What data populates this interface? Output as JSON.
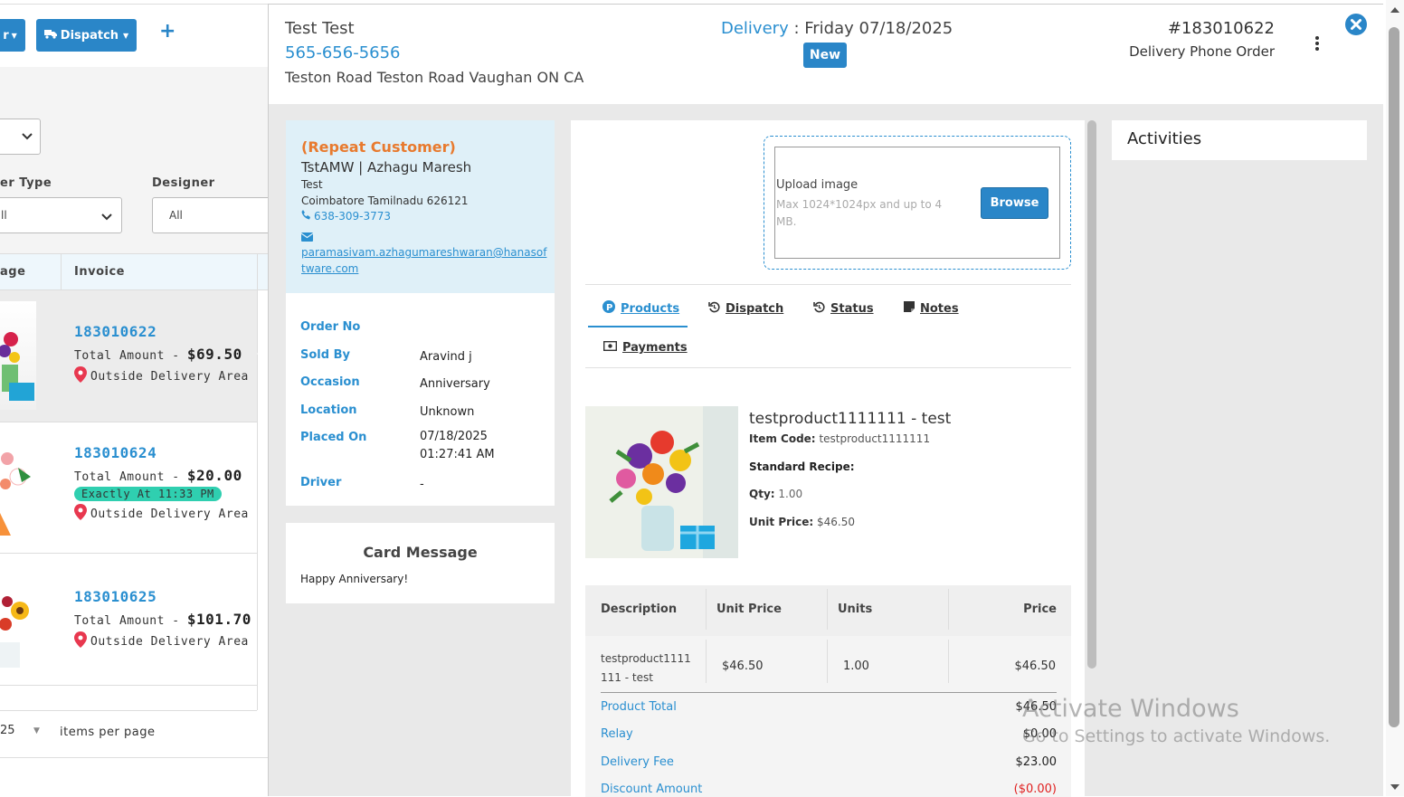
{
  "toolbar": {
    "partial_button_label": "r",
    "dispatch_label": "Dispatch",
    "add_label": "+"
  },
  "filters": {
    "order_type_label": "er Type",
    "order_type_value": "ll",
    "designer_label": "Designer",
    "designer_value": "All"
  },
  "list": {
    "col_stage": "age",
    "col_invoice": "Invoice",
    "rows": [
      {
        "invoice": "183010622",
        "amount_label": "Total Amount -",
        "amount": "$69.50",
        "badge": "",
        "location": "Outside Delivery Area"
      },
      {
        "invoice": "183010624",
        "amount_label": "Total Amount -",
        "amount": "$20.00",
        "badge": "Exactly At 11:33 PM",
        "location": "Outside Delivery Area"
      },
      {
        "invoice": "183010625",
        "amount_label": "Total Amount -",
        "amount": "$101.70",
        "badge": "",
        "location": "Outside Delivery Area"
      }
    ],
    "page_size": "25",
    "per_page_label": "items per page"
  },
  "header": {
    "customer_name": "Test Test",
    "phone": "565-656-5656",
    "address": "Teston Road Teston Road Vaughan ON CA",
    "delivery_label": "Delivery",
    "delivery_date": ": Friday 07/18/2025",
    "status_badge": "New",
    "order_number": "#183010622",
    "order_type": "Delivery Phone Order"
  },
  "customer_card": {
    "repeat_label": "(Repeat Customer)",
    "name": "TstAMW | Azhagu Maresh",
    "line1": "Test",
    "line2": "Coimbatore Tamilnadu 626121",
    "phone": "638-309-3773",
    "email_line1": "paramasivam.azhagumareshwaran@hanasof",
    "email_line2": "tware.com"
  },
  "order_details": [
    {
      "key": "Order No",
      "value": ""
    },
    {
      "key": "Sold By",
      "value": "Aravind j"
    },
    {
      "key": "Occasion",
      "value": "Anniversary"
    },
    {
      "key": "Location",
      "value": "Unknown"
    },
    {
      "key": "Placed On",
      "value": "07/18/2025 01:27:41 AM"
    },
    {
      "key": "Driver",
      "value": "-"
    }
  ],
  "card_message": {
    "title": "Card Message",
    "text": "Happy Anniversary!"
  },
  "upload": {
    "title": "Upload image",
    "hint": "Max 1024*1024px and up to 4 MB.",
    "browse_label": "Browse"
  },
  "tabs": {
    "products": "Products",
    "dispatch": "Dispatch",
    "status": "Status",
    "notes": "Notes",
    "payments": "Payments"
  },
  "product": {
    "name": "testproduct1111111 - test",
    "item_code_label": "Item Code:",
    "item_code": "testproduct1111111",
    "recipe_label": "Standard Recipe:",
    "qty_label": "Qty:",
    "qty": "1.00",
    "unit_price_label": "Unit Price:",
    "unit_price": "$46.50"
  },
  "line_table": {
    "headers": [
      "Description",
      "Unit Price",
      "Units",
      "Price"
    ],
    "row": {
      "description": "testproduct1111111 - test",
      "unit_price": "$46.50",
      "units": "1.00",
      "price": "$46.50"
    }
  },
  "totals": [
    {
      "label": "Product Total",
      "value": "$46.50"
    },
    {
      "label": "Relay",
      "value": "$0.00"
    },
    {
      "label": "Delivery Fee",
      "value": "$23.00"
    },
    {
      "label": "Discount Amount",
      "value": "($0.00)"
    }
  ],
  "activities": {
    "title": "Activities"
  },
  "watermark": {
    "line1": "Activate Windows",
    "line2": "Go to Settings to activate Windows."
  },
  "colors": {
    "accent": "#2a8fd0",
    "button": "#2a86c8",
    "repeat": "#e87a2e",
    "badge_green": "#2fcfb0",
    "customer_bg": "#dff0f8",
    "discount": "#e02020"
  }
}
